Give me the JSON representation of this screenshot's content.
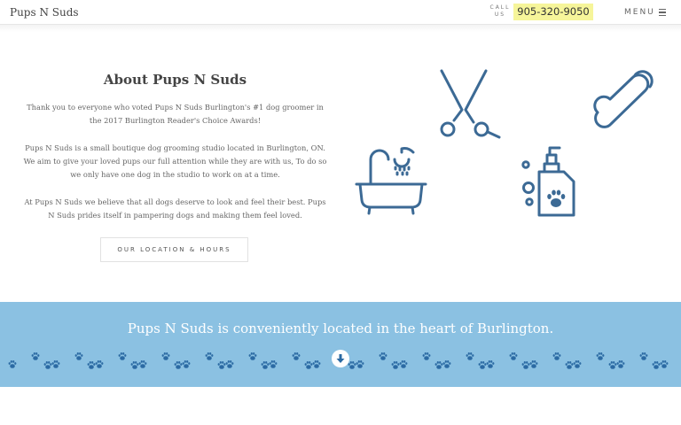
{
  "header": {
    "logo": "Pups N Suds",
    "call_label": "CALL US",
    "phone": "905-320-9050",
    "menu_label": "MENU",
    "menu_icon": "hamburger-icon"
  },
  "about": {
    "title": "About Pups N Suds",
    "paragraph1": "Thank you to everyone who voted Pups N Suds Burlington's #1 dog groomer in the 2017 Burlington Reader's Choice Awards!",
    "paragraph2": "Pups N Suds is a small boutique dog grooming studio located in Burlington, ON. We aim to give your loved pups our full attention while they are with us, To do so we only have one dog in the studio to work on at a time.",
    "paragraph3": "At Pups N Suds we believe that all dogs deserve to look and feel their best. Pups N Suds prides itself in pampering dogs and making them feel loved.",
    "button_label": "OUR LOCATION & HOURS"
  },
  "icons": [
    "scissors-icon",
    "bone-icon",
    "bathtub-shower-icon",
    "shampoo-bottle-icon"
  ],
  "band": {
    "text": "Pups N Suds is conveniently located in the heart of Burlington.",
    "scroll_icon": "arrow-down-icon"
  },
  "colors": {
    "icon_blue": "#3c6a95",
    "band_blue": "#8bc1e2",
    "paw_blue": "#2b6aa3",
    "phone_highlight": "#f6f59a"
  }
}
